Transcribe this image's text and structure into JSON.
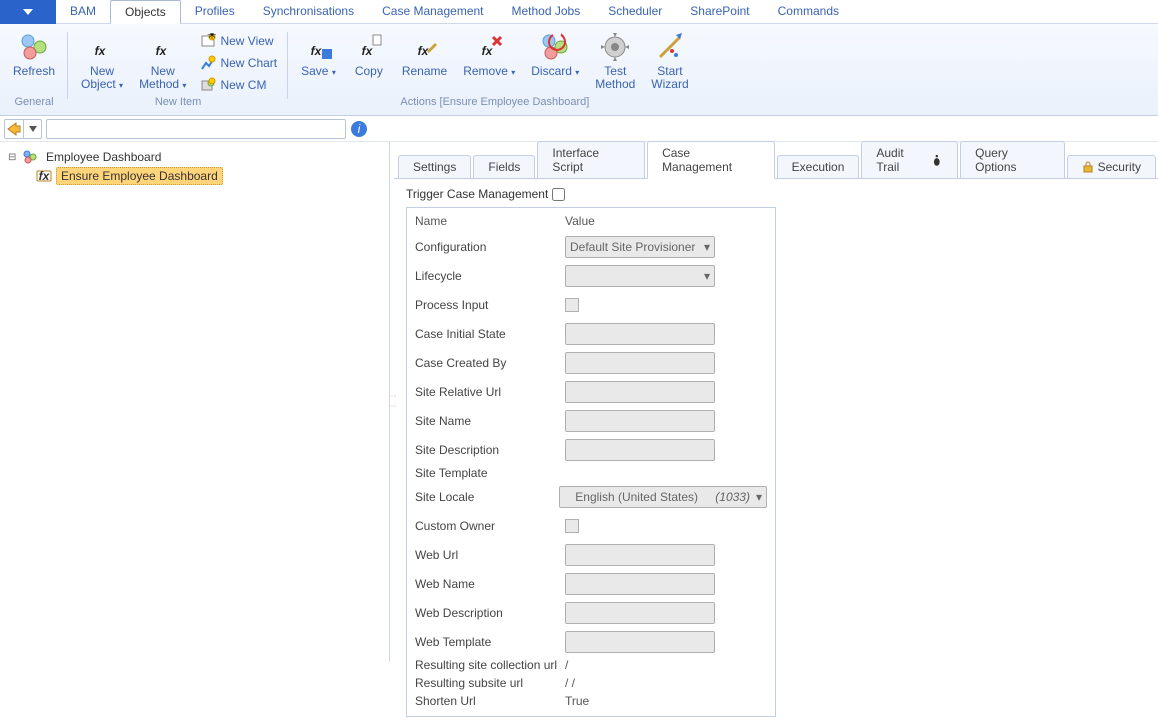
{
  "menu": [
    "BAM",
    "Objects",
    "Profiles",
    "Synchronisations",
    "Case Management",
    "Method Jobs",
    "Scheduler",
    "SharePoint",
    "Commands"
  ],
  "menu_active": "Objects",
  "ribbon": {
    "groups": [
      {
        "label": "General",
        "big": [
          {
            "label": "Refresh"
          }
        ]
      },
      {
        "label": "New Item",
        "big": [
          {
            "label": "New\nObject",
            "dd": true
          },
          {
            "label": "New\nMethod",
            "dd": true
          }
        ],
        "smalls": [
          "New View",
          "New Chart",
          "New CM"
        ]
      },
      {
        "label": "Actions [Ensure Employee Dashboard]",
        "big": [
          {
            "label": "Save",
            "dd": true
          },
          {
            "label": "Copy"
          },
          {
            "label": "Rename"
          },
          {
            "label": "Remove",
            "dd": true
          },
          {
            "label": "Discard",
            "dd": true
          },
          {
            "label": "Test\nMethod"
          },
          {
            "label": "Start\nWizard"
          }
        ]
      }
    ]
  },
  "tree": {
    "root": "Employee Dashboard",
    "child": "Ensure Employee Dashboard"
  },
  "tabs": [
    "Settings",
    "Fields",
    "Interface Script",
    "Case Management",
    "Execution",
    "Audit Trail",
    "Query Options",
    "Security"
  ],
  "tabs_active": "Case Management",
  "trigger_label": "Trigger Case Management",
  "form": {
    "header": {
      "name": "Name",
      "value": "Value"
    },
    "rows": [
      {
        "label": "Configuration",
        "type": "select",
        "value": "Default Site Provisioner"
      },
      {
        "label": "Lifecycle",
        "type": "select",
        "value": ""
      },
      {
        "label": "Process Input",
        "type": "check"
      },
      {
        "label": "Case Initial State",
        "type": "text"
      },
      {
        "label": "Case Created By",
        "type": "text"
      },
      {
        "label": "Site Relative Url",
        "type": "text"
      },
      {
        "label": "Site Name",
        "type": "text"
      },
      {
        "label": "Site Description",
        "type": "text"
      },
      {
        "label": "Site Template",
        "type": "label"
      },
      {
        "label": "Site Locale",
        "type": "wideselect",
        "value": "English (United States)",
        "hint": "(1033)"
      },
      {
        "label": "Custom Owner",
        "type": "check"
      },
      {
        "label": "Web Url",
        "type": "text"
      },
      {
        "label": "Web Name",
        "type": "text"
      },
      {
        "label": "Web Description",
        "type": "text"
      },
      {
        "label": "Web Template",
        "type": "text"
      },
      {
        "label": "Resulting site collection url",
        "type": "static",
        "value": "/"
      },
      {
        "label": "Resulting subsite url",
        "type": "static",
        "value": "/ /"
      },
      {
        "label": "Shorten Url",
        "type": "static",
        "value": "True"
      }
    ]
  }
}
